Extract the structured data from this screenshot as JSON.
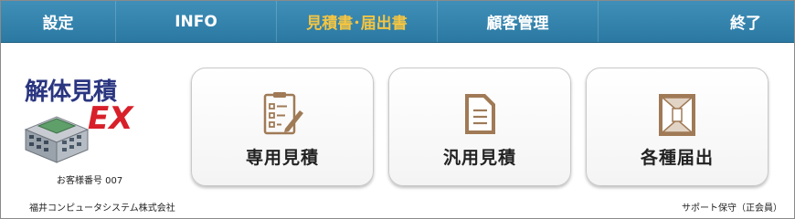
{
  "nav": {
    "items": [
      {
        "label": "設定"
      },
      {
        "label": "INFO"
      },
      {
        "label": "見積書･届出書"
      },
      {
        "label": "顧客管理"
      },
      {
        "label": "終了"
      }
    ]
  },
  "logo": {
    "title": "解体見積",
    "ex": "EX",
    "icon": "building-icon"
  },
  "customer": {
    "number_text": "お客様番号 007"
  },
  "tiles": [
    {
      "label": "専用見積",
      "icon": "clipboard-checklist-icon"
    },
    {
      "label": "汎用見積",
      "icon": "document-icon"
    },
    {
      "label": "各種届出",
      "icon": "envelope-icon"
    }
  ],
  "footer": {
    "company": "福井コンピュータシステム株式会社",
    "support": "サポート保守（正会員）"
  },
  "colors": {
    "nav_bg": "#2b79a3",
    "nav_active": "#f4c542",
    "icon_brown": "#a07a56",
    "logo_blue": "#2a3580",
    "logo_red": "#d8202a"
  }
}
